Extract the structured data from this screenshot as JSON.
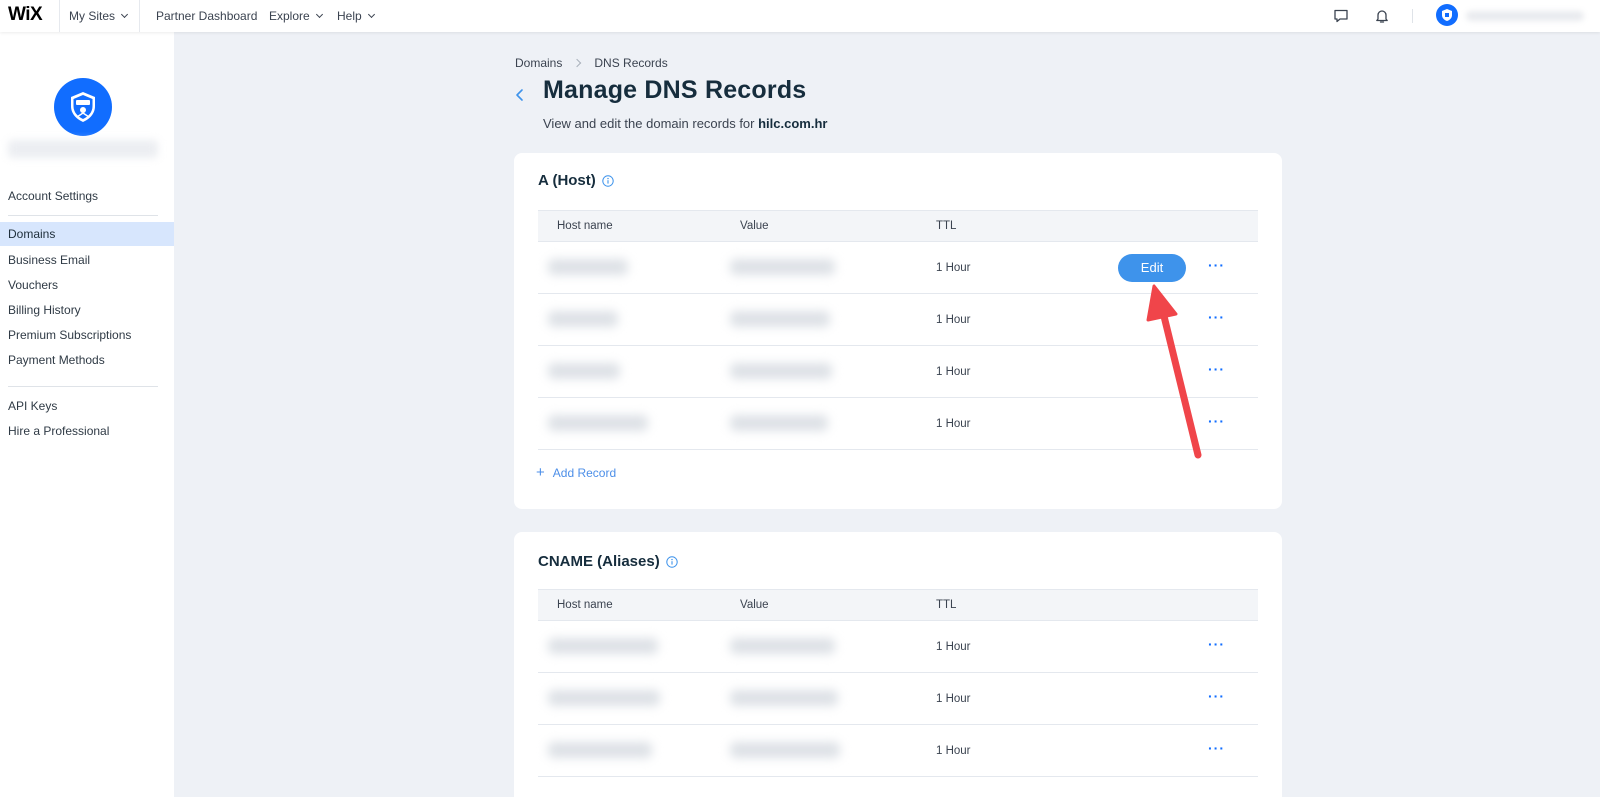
{
  "topbar": {
    "logo": "WiX",
    "nav": [
      {
        "label": "My Sites",
        "has_dropdown": true
      },
      {
        "label": "Partner Dashboard",
        "has_dropdown": false
      },
      {
        "label": "Explore",
        "has_dropdown": true
      },
      {
        "label": "Help",
        "has_dropdown": true
      }
    ],
    "icons": [
      "chat-icon",
      "bell-icon",
      "user-avatar"
    ]
  },
  "sidebar": {
    "items": [
      {
        "label": "Account Settings",
        "active": false
      },
      {
        "label": "Domains",
        "active": true
      },
      {
        "label": "Business Email",
        "active": false
      },
      {
        "label": "Vouchers",
        "active": false
      },
      {
        "label": "Billing History",
        "active": false
      },
      {
        "label": "Premium Subscriptions",
        "active": false
      },
      {
        "label": "Payment Methods",
        "active": false
      },
      {
        "label": "API Keys",
        "active": false
      },
      {
        "label": "Hire a Professional",
        "active": false
      }
    ]
  },
  "breadcrumb": {
    "items": [
      "Domains",
      "DNS Records"
    ]
  },
  "page": {
    "title": "Manage DNS Records",
    "subtitle_prefix": "View and edit the domain records for ",
    "domain": "hilc.com.hr"
  },
  "columns": {
    "host": "Host name",
    "value": "Value",
    "ttl": "TTL"
  },
  "a_records": {
    "title": "A (Host)",
    "rows": [
      {
        "ttl": "1 Hour",
        "edit_label": "Edit"
      },
      {
        "ttl": "1 Hour"
      },
      {
        "ttl": "1 Hour"
      },
      {
        "ttl": "1 Hour"
      }
    ],
    "add_label": "Add Record",
    "more_label": "···"
  },
  "cname_records": {
    "title": "CNAME (Aliases)",
    "rows": [
      {
        "ttl": "1 Hour"
      },
      {
        "ttl": "1 Hour"
      },
      {
        "ttl": "1 Hour"
      }
    ],
    "more_label": "···"
  },
  "colors": {
    "accent": "#116dff",
    "edit_button": "#3e93eb",
    "arrow": "#f0454a"
  }
}
